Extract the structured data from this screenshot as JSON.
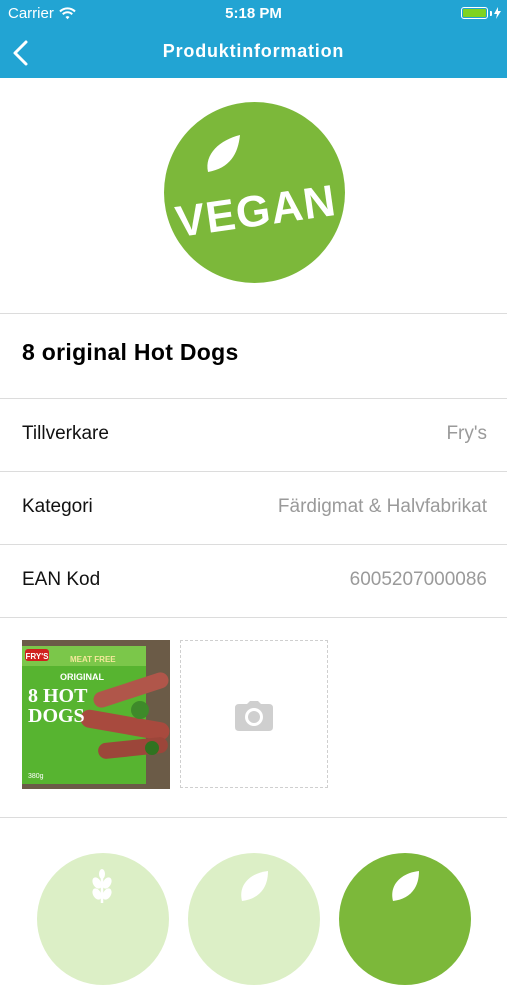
{
  "status_bar": {
    "carrier": "Carrier",
    "time": "5:18 PM"
  },
  "nav": {
    "title": "Produktinformation",
    "back_icon": "chevron-left-icon"
  },
  "badge": {
    "text": "VEGAN",
    "color": "#7cb83a",
    "icon": "leaf-icon"
  },
  "product": {
    "name": "8 original Hot Dogs"
  },
  "details": [
    {
      "label": "Tillverkare",
      "value": "Fry's"
    },
    {
      "label": "Kategori",
      "value": "Färdigmat & Halvfabrikat"
    },
    {
      "label": "EAN Kod",
      "value": "6005207000086"
    }
  ],
  "photos": {
    "product_photo": {
      "brand": "FRY'S",
      "tag": "MEAT FREE",
      "line1": "ORIGINAL",
      "line2": "8 HOT",
      "line3": "DOGS",
      "weight": "380g"
    },
    "add_icon": "camera-icon"
  },
  "categories": [
    {
      "icon": "wheat-icon",
      "color": "#dcefc6"
    },
    {
      "icon": "leaf-icon",
      "color": "#dcefc6"
    },
    {
      "icon": "leaf-icon",
      "color": "#7cb83a"
    }
  ],
  "colors": {
    "header": "#22a4d3",
    "accent_green": "#7cb83a",
    "value_gray": "#9a9a9a"
  }
}
